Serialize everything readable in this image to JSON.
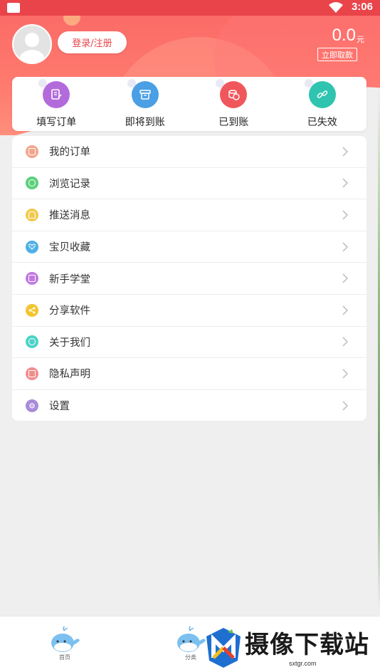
{
  "status_bar": {
    "time": "3:06"
  },
  "profile": {
    "login_label": "登录/注册",
    "balance": "0.0",
    "balance_unit": "元",
    "withdraw_label": "立即取款"
  },
  "orders": [
    {
      "label": "填写订单",
      "icon": "edit-order-icon",
      "color": "#b36bdc"
    },
    {
      "label": "即将到账",
      "icon": "pending-icon",
      "color": "#4a9fe5"
    },
    {
      "label": "已到账",
      "icon": "coins-icon",
      "color": "#f0575c"
    },
    {
      "label": "已失效",
      "icon": "broken-link-icon",
      "color": "#2ec4b0"
    }
  ],
  "menu": [
    {
      "label": "我的订单",
      "icon": "order-list-icon",
      "color": "#f4a58a"
    },
    {
      "label": "浏览记录",
      "icon": "history-icon",
      "color": "#5bd07a"
    },
    {
      "label": "推送消息",
      "icon": "bell-icon",
      "color": "#f2c94c"
    },
    {
      "label": "宝贝收藏",
      "icon": "heart-icon",
      "color": "#4fb0e6"
    },
    {
      "label": "新手学堂",
      "icon": "book-icon",
      "color": "#c07ae0"
    },
    {
      "label": "分享软件",
      "icon": "share-icon",
      "color": "#f4c430"
    },
    {
      "label": "关于我们",
      "icon": "info-icon",
      "color": "#4dd2c9"
    },
    {
      "label": "隐私声明",
      "icon": "lock-icon",
      "color": "#f28c8c"
    },
    {
      "label": "设置",
      "icon": "gear-icon",
      "color": "#a98bd8"
    }
  ],
  "bottom_nav": {
    "tabs": [
      {
        "label": "首页",
        "icon": "whale-icon"
      },
      {
        "label": "分类",
        "icon": "whale-icon"
      }
    ]
  },
  "watermark": {
    "text": "摄像下载站",
    "url": "sxtgr.com"
  },
  "colors": {
    "accent": "#e9444a",
    "header": "#fb6b67",
    "background": "#efefef"
  }
}
